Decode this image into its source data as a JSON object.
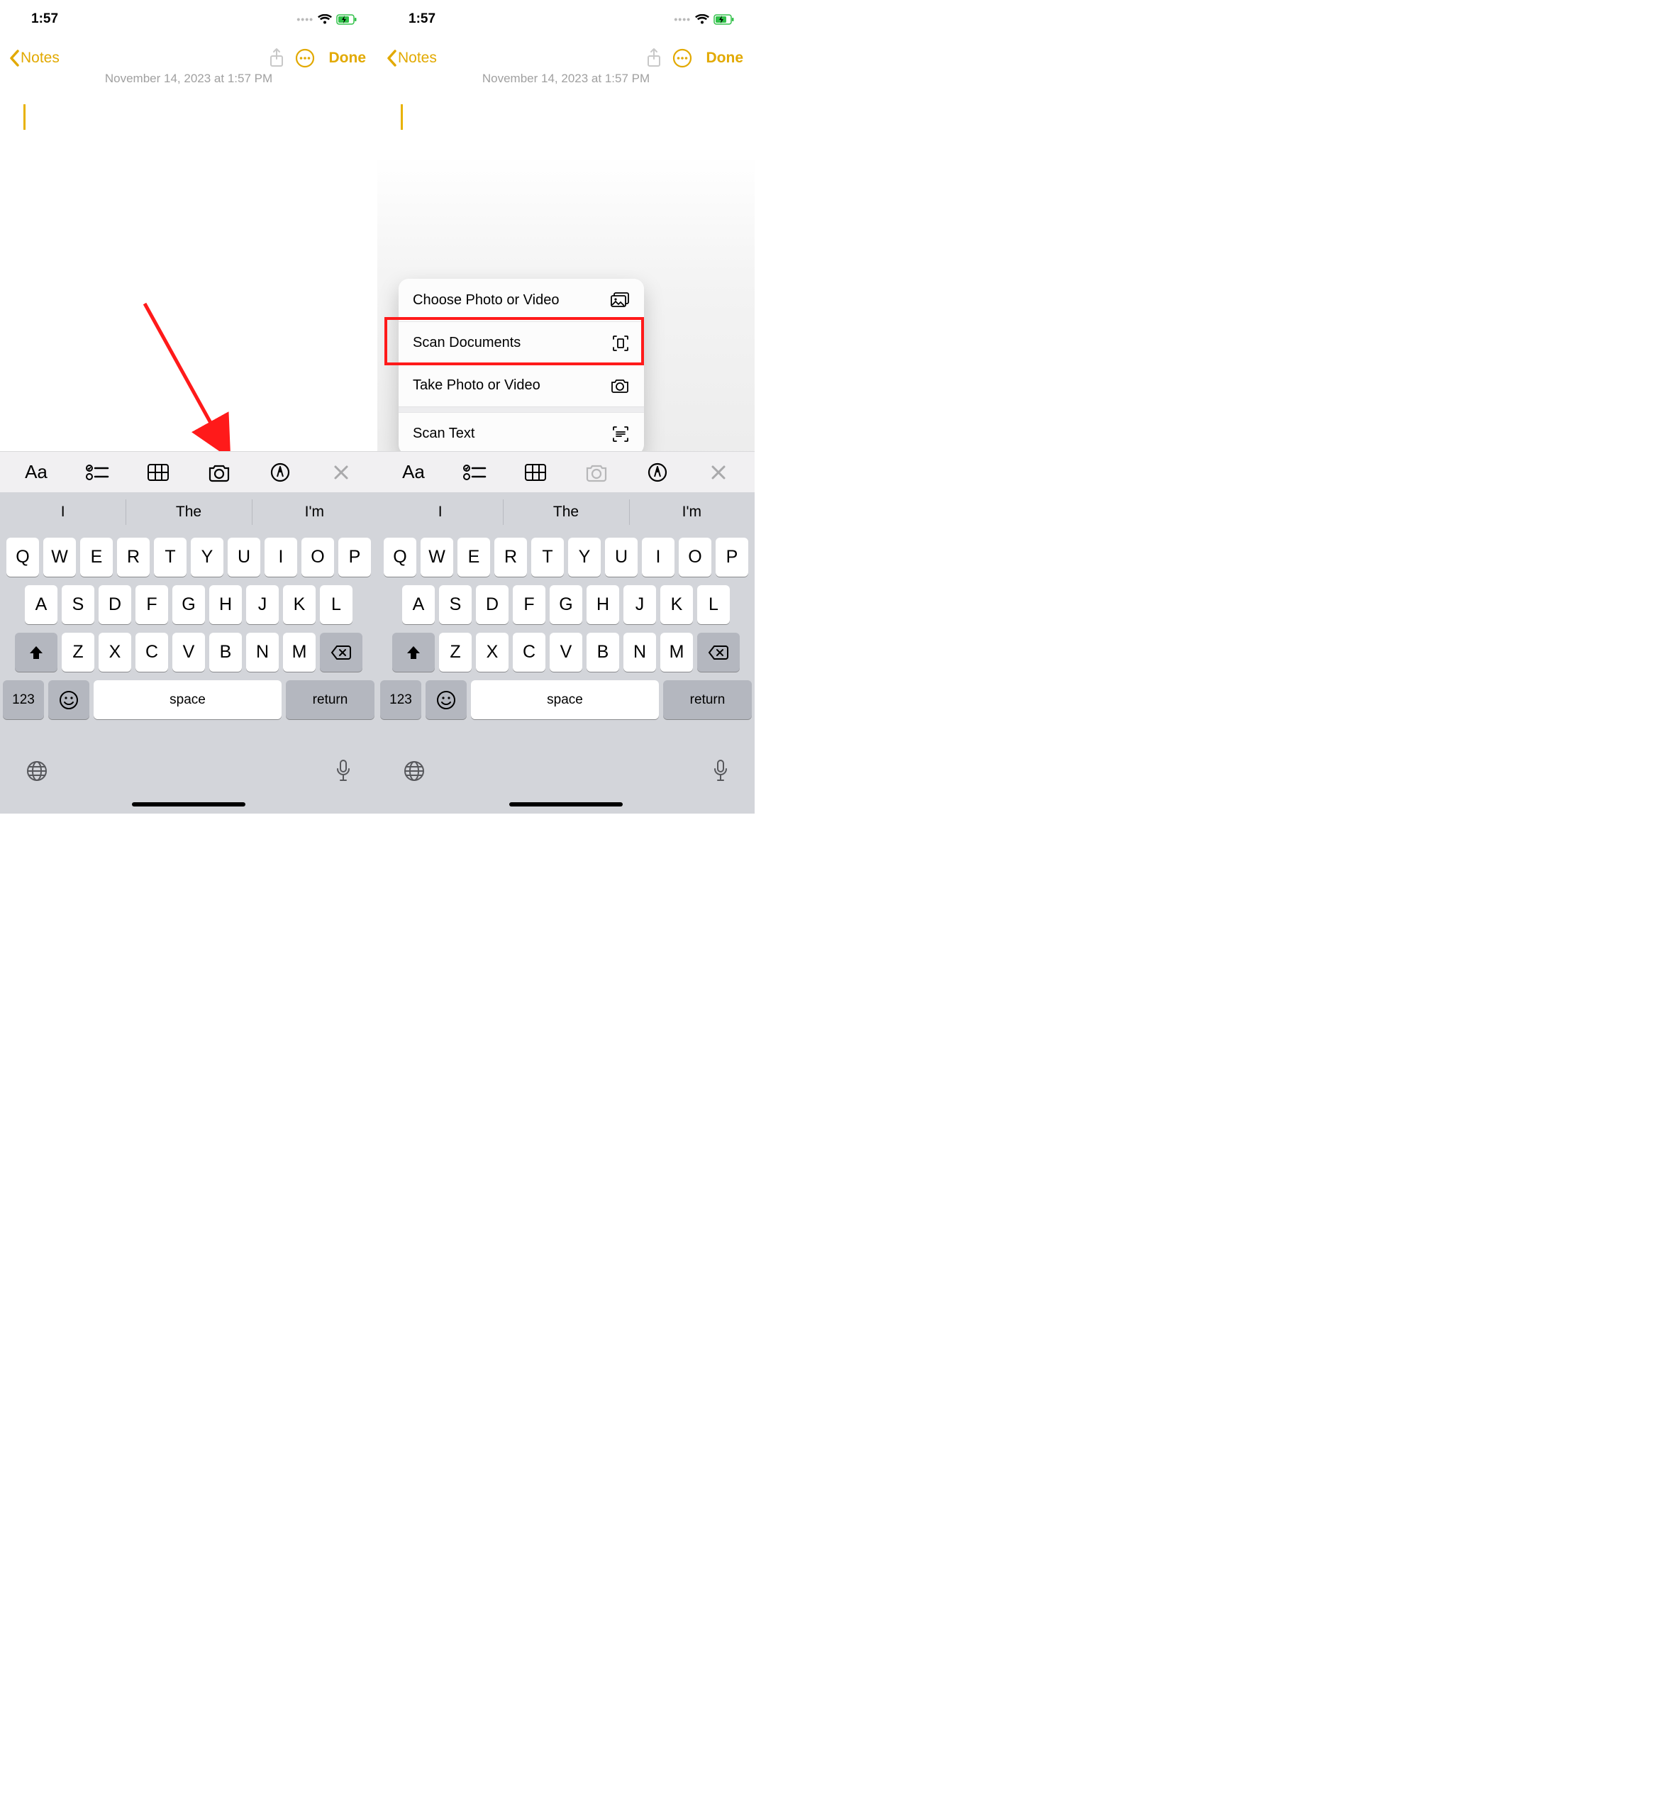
{
  "status": {
    "time": "1:57"
  },
  "nav": {
    "back_label": "Notes",
    "done_label": "Done"
  },
  "note": {
    "date": "November 14, 2023 at 1:57 PM"
  },
  "suggest": [
    "I",
    "The",
    "I'm"
  ],
  "keyboard": {
    "row1": [
      "Q",
      "W",
      "E",
      "R",
      "T",
      "Y",
      "U",
      "I",
      "O",
      "P"
    ],
    "row2": [
      "A",
      "S",
      "D",
      "F",
      "G",
      "H",
      "J",
      "K",
      "L"
    ],
    "row3": [
      "Z",
      "X",
      "C",
      "V",
      "B",
      "N",
      "M"
    ],
    "num": "123",
    "space": "space",
    "return": "return"
  },
  "popup": {
    "items": [
      {
        "label": "Choose Photo or Video",
        "icon": "photos"
      },
      {
        "label": "Scan Documents",
        "icon": "docscan"
      },
      {
        "label": "Take Photo or Video",
        "icon": "camera"
      },
      {
        "label": "Scan Text",
        "icon": "textscan"
      }
    ]
  }
}
